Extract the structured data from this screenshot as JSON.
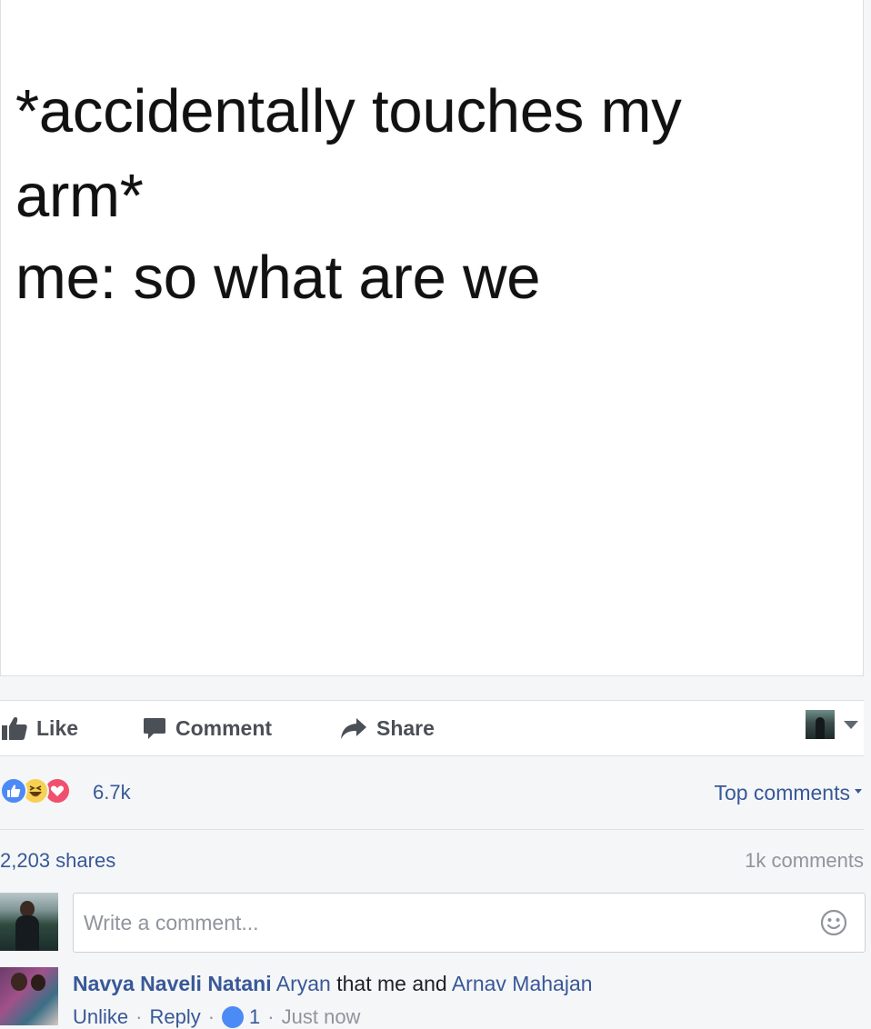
{
  "post": {
    "image_text": {
      "line1": "*accidentally touches my",
      "line2": "arm*",
      "line3": "me: so what are we"
    }
  },
  "actions": {
    "like_label": "Like",
    "comment_label": "Comment",
    "share_label": "Share"
  },
  "reactions": {
    "types": [
      "like",
      "haha",
      "love"
    ],
    "count": "6.7k",
    "sort_label": "Top comments"
  },
  "stats": {
    "shares": "2,203 shares",
    "comments": "1k comments"
  },
  "composer": {
    "placeholder": "Write a comment..."
  },
  "comment": {
    "author": "Navya Naveli Natani",
    "mention1": "Aryan",
    "text": "that me and",
    "mention2": "Arnav Mahajan",
    "unlike_label": "Unlike",
    "reply_label": "Reply",
    "reaction_count": "1",
    "timestamp": "Just now"
  },
  "colors": {
    "link": "#385898",
    "muted": "#90949c",
    "like_blue": "#4c8bf5",
    "love_red": "#f0506e",
    "haha_yellow": "#f7d154"
  }
}
